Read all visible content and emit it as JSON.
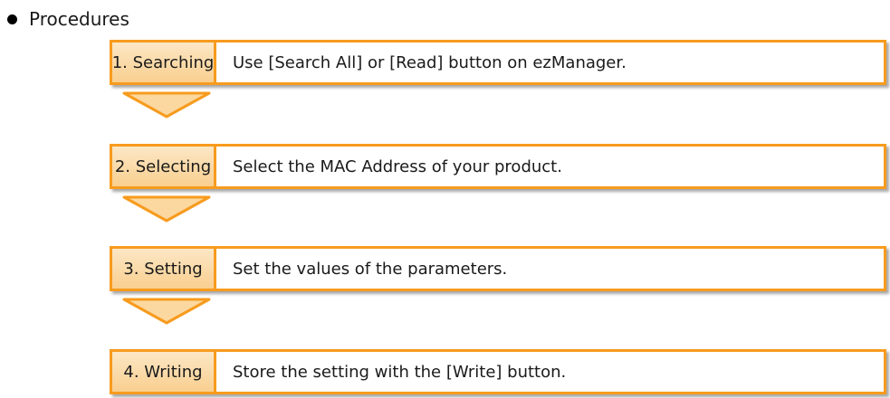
{
  "heading": "Procedures",
  "steps": [
    {
      "label": "1. Searching",
      "desc": "Use [Search All] or [Read] button on ezManager."
    },
    {
      "label": "2. Selecting",
      "desc": "Select the MAC Address of your product."
    },
    {
      "label": "3. Setting",
      "desc": "Set the values of the parameters."
    },
    {
      "label": "4. Writing",
      "desc": "Store the setting with the [Write] button."
    }
  ],
  "colors": {
    "border": "#f79b1e",
    "label_fill_top": "#fce7c5",
    "label_fill_bottom": "#f9cf8f",
    "arrow_fill": "#fbd8a0"
  }
}
